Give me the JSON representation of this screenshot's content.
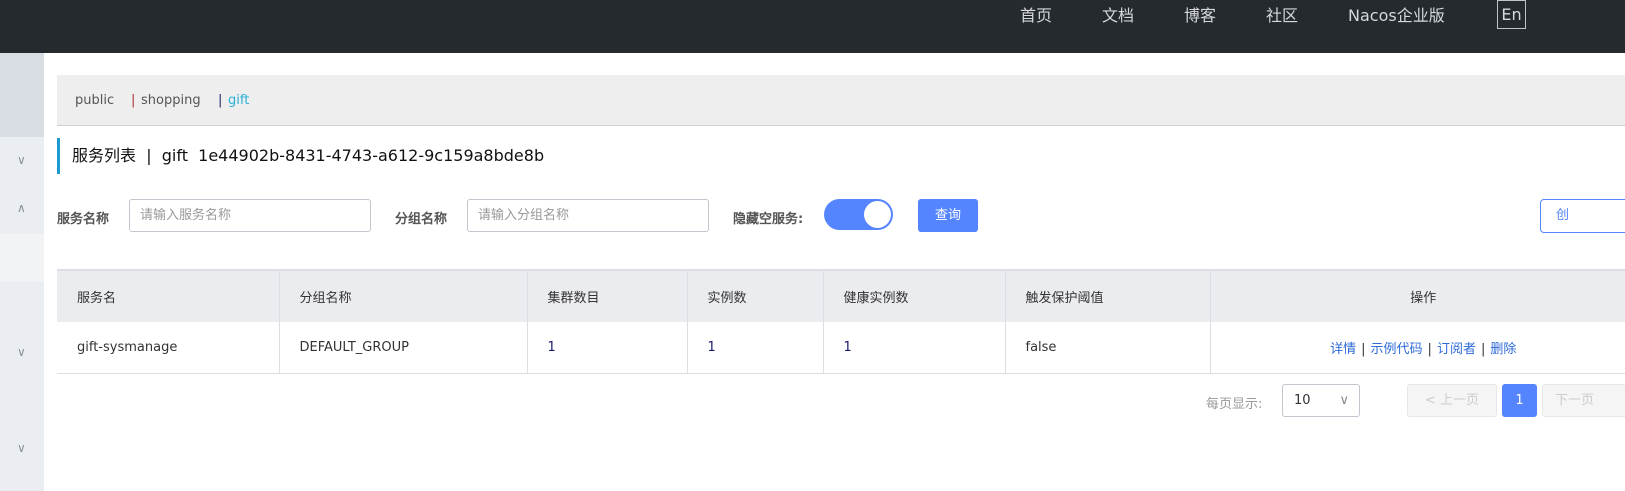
{
  "topnav": {
    "items": [
      "首页",
      "文档",
      "博客",
      "社区",
      "Nacos企业版"
    ],
    "lang": "En"
  },
  "namespaces": [
    {
      "label": "public"
    },
    {
      "label": "shopping"
    },
    {
      "label": "gift"
    }
  ],
  "title": {
    "main": "服务列表",
    "sep": "|",
    "ns": "gift",
    "id": "1e44902b-8431-4743-a612-9c159a8bde8b"
  },
  "filters": {
    "service_label": "服务名称",
    "service_placeholder": "请输入服务名称",
    "group_label": "分组名称",
    "group_placeholder": "请输入分组名称",
    "hide_empty_label": "隐藏空服务:",
    "hide_empty": true,
    "query": "查询",
    "create": "创"
  },
  "table": {
    "headers": [
      "服务名",
      "分组名称",
      "集群数目",
      "实例数",
      "健康实例数",
      "触发保护阈值",
      "操作"
    ],
    "rows": [
      {
        "name": "gift-sysmanage",
        "group": "DEFAULT_GROUP",
        "clusters": "1",
        "instances": "1",
        "healthy": "1",
        "threshold": "false"
      }
    ],
    "actions": [
      "详情",
      "示例代码",
      "订阅者",
      "删除"
    ]
  },
  "pagination": {
    "page_size_label": "每页显示:",
    "page_size": "10",
    "prev": "上一页",
    "current": "1",
    "next": "下一页"
  }
}
